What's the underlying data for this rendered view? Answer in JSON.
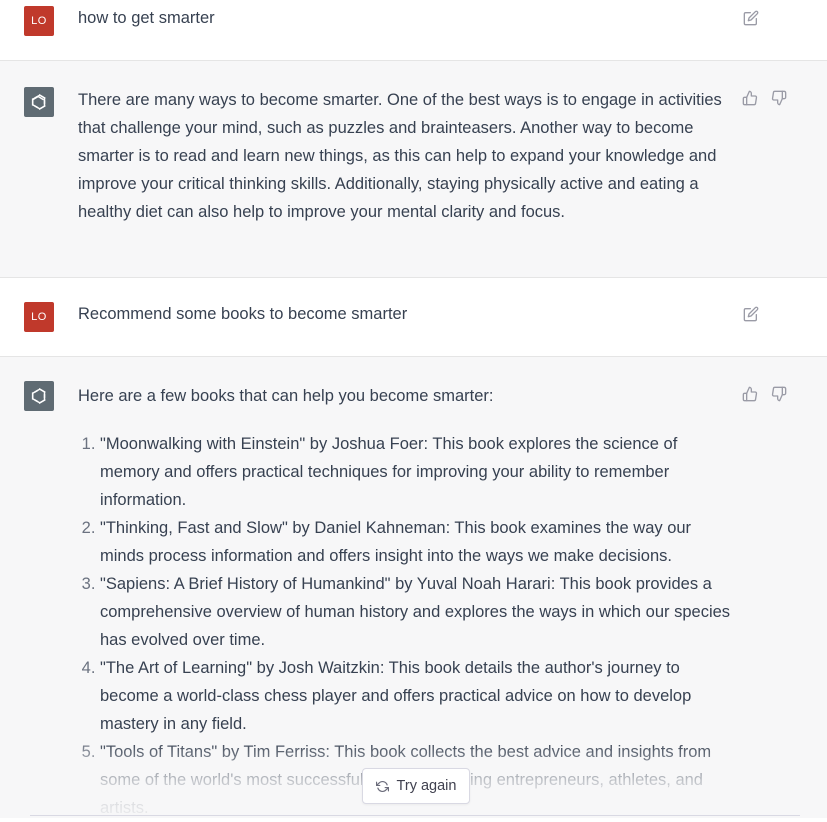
{
  "conversation": {
    "messages": [
      {
        "role": "user",
        "avatar_initials": "LO",
        "text": "how to get smarter"
      },
      {
        "role": "assistant",
        "text": "There are many ways to become smarter. One of the best ways is to engage in activities that challenge your mind, such as puzzles and brainteasers. Another way to become smarter is to read and learn new things, as this can help to expand your knowledge and improve your critical thinking skills. Additionally, staying physically active and eating a healthy diet can also help to improve your mental clarity and focus."
      },
      {
        "role": "user",
        "avatar_initials": "LO",
        "text": "Recommend some books to become smarter"
      },
      {
        "role": "assistant",
        "intro": "Here are a few books that can help you become smarter:",
        "list": [
          "\"Moonwalking with Einstein\" by Joshua Foer: This book explores the science of memory and offers practical techniques for improving your ability to remember information.",
          "\"Thinking, Fast and Slow\" by Daniel Kahneman: This book examines the way our minds process information and offers insight into the ways we make decisions.",
          "\"Sapiens: A Brief History of Humankind\" by Yuval Noah Harari: This book provides a comprehensive overview of human history and explores the ways in which our species has evolved over time.",
          "\"The Art of Learning\" by Josh Waitzkin: This book details the author's journey to become a world-class chess player and offers practical advice on how to develop mastery in any field.",
          "\"Tools of Titans\" by Tim Ferriss: This book collects the best advice and insights from some of the world's most successful people, including entrepreneurs, athletes, and artists."
        ]
      }
    ]
  },
  "controls": {
    "try_again_label": "Try again"
  },
  "icons": {
    "edit": "edit-icon",
    "thumbs_up": "thumbs-up-icon",
    "thumbs_down": "thumbs-down-icon",
    "assistant_logo": "openai-logo-icon",
    "refresh": "refresh-icon"
  },
  "colors": {
    "user_avatar": "#c0392b",
    "assistant_avatar": "#5f6b73",
    "assistant_bg": "#f7f7f8"
  }
}
